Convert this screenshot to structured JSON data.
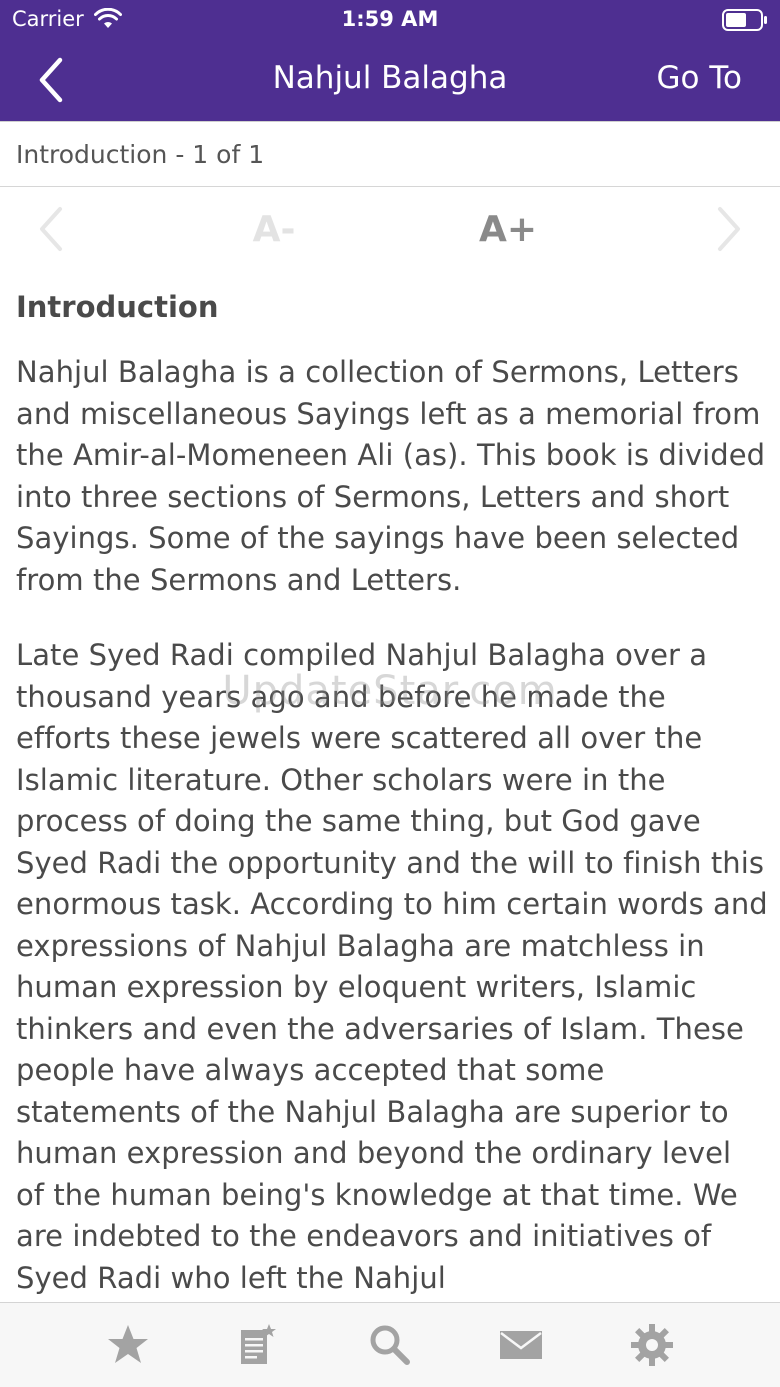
{
  "status_bar": {
    "carrier": "Carrier",
    "time": "1:59 AM",
    "icons": [
      "wifi-icon",
      "battery-icon"
    ]
  },
  "nav": {
    "back_icon": "chevron-left-icon",
    "title": "Nahjul Balagha",
    "goto_label": "Go To"
  },
  "subheader": {
    "text": "Introduction - 1 of 1"
  },
  "toolbar": {
    "prev_icon": "chevron-left-icon",
    "font_decrease_label": "A-",
    "font_increase_label": "A+",
    "next_icon": "chevron-right-icon"
  },
  "content": {
    "heading": "Introduction",
    "paragraphs": [
      "Nahjul Balagha is a collection of Sermons, Letters and miscellaneous Sayings left as a memorial from the Amir-al-Momeneen Ali (as). This book is divided into three sections of Sermons, Letters and short Sayings. Some of the sayings have been selected from the Sermons and Letters.",
      "Late Syed Radi compiled Nahjul Balagha over a thousand years ago and before he made the efforts these jewels were scattered all over the Islamic literature. Other scholars were in the process of doing the same thing, but God gave Syed Radi the opportunity and the will to finish this enormous task. According to him certain words and expressions of Nahjul Balagha are matchless in human expression by eloquent writers, Islamic thinkers and even the adversaries of Islam. These people have always accepted that some statements of the Nahjul Balagha are superior to human expression and beyond the ordinary level of the human being's knowledge at that time. We are indebted to the endeavors and initiatives of Syed Radi who left the Nahjul"
    ]
  },
  "watermark": "UpdateStar.com",
  "tab_bar": {
    "tabs": [
      "star-icon",
      "notes-icon",
      "search-icon",
      "mail-icon",
      "settings-gear-icon"
    ]
  },
  "colors": {
    "header_background": "#4e2f91",
    "text": "#4a4a4a",
    "icon_gray": "#a0a0a0",
    "tab_bar_background": "#f7f7f7"
  }
}
